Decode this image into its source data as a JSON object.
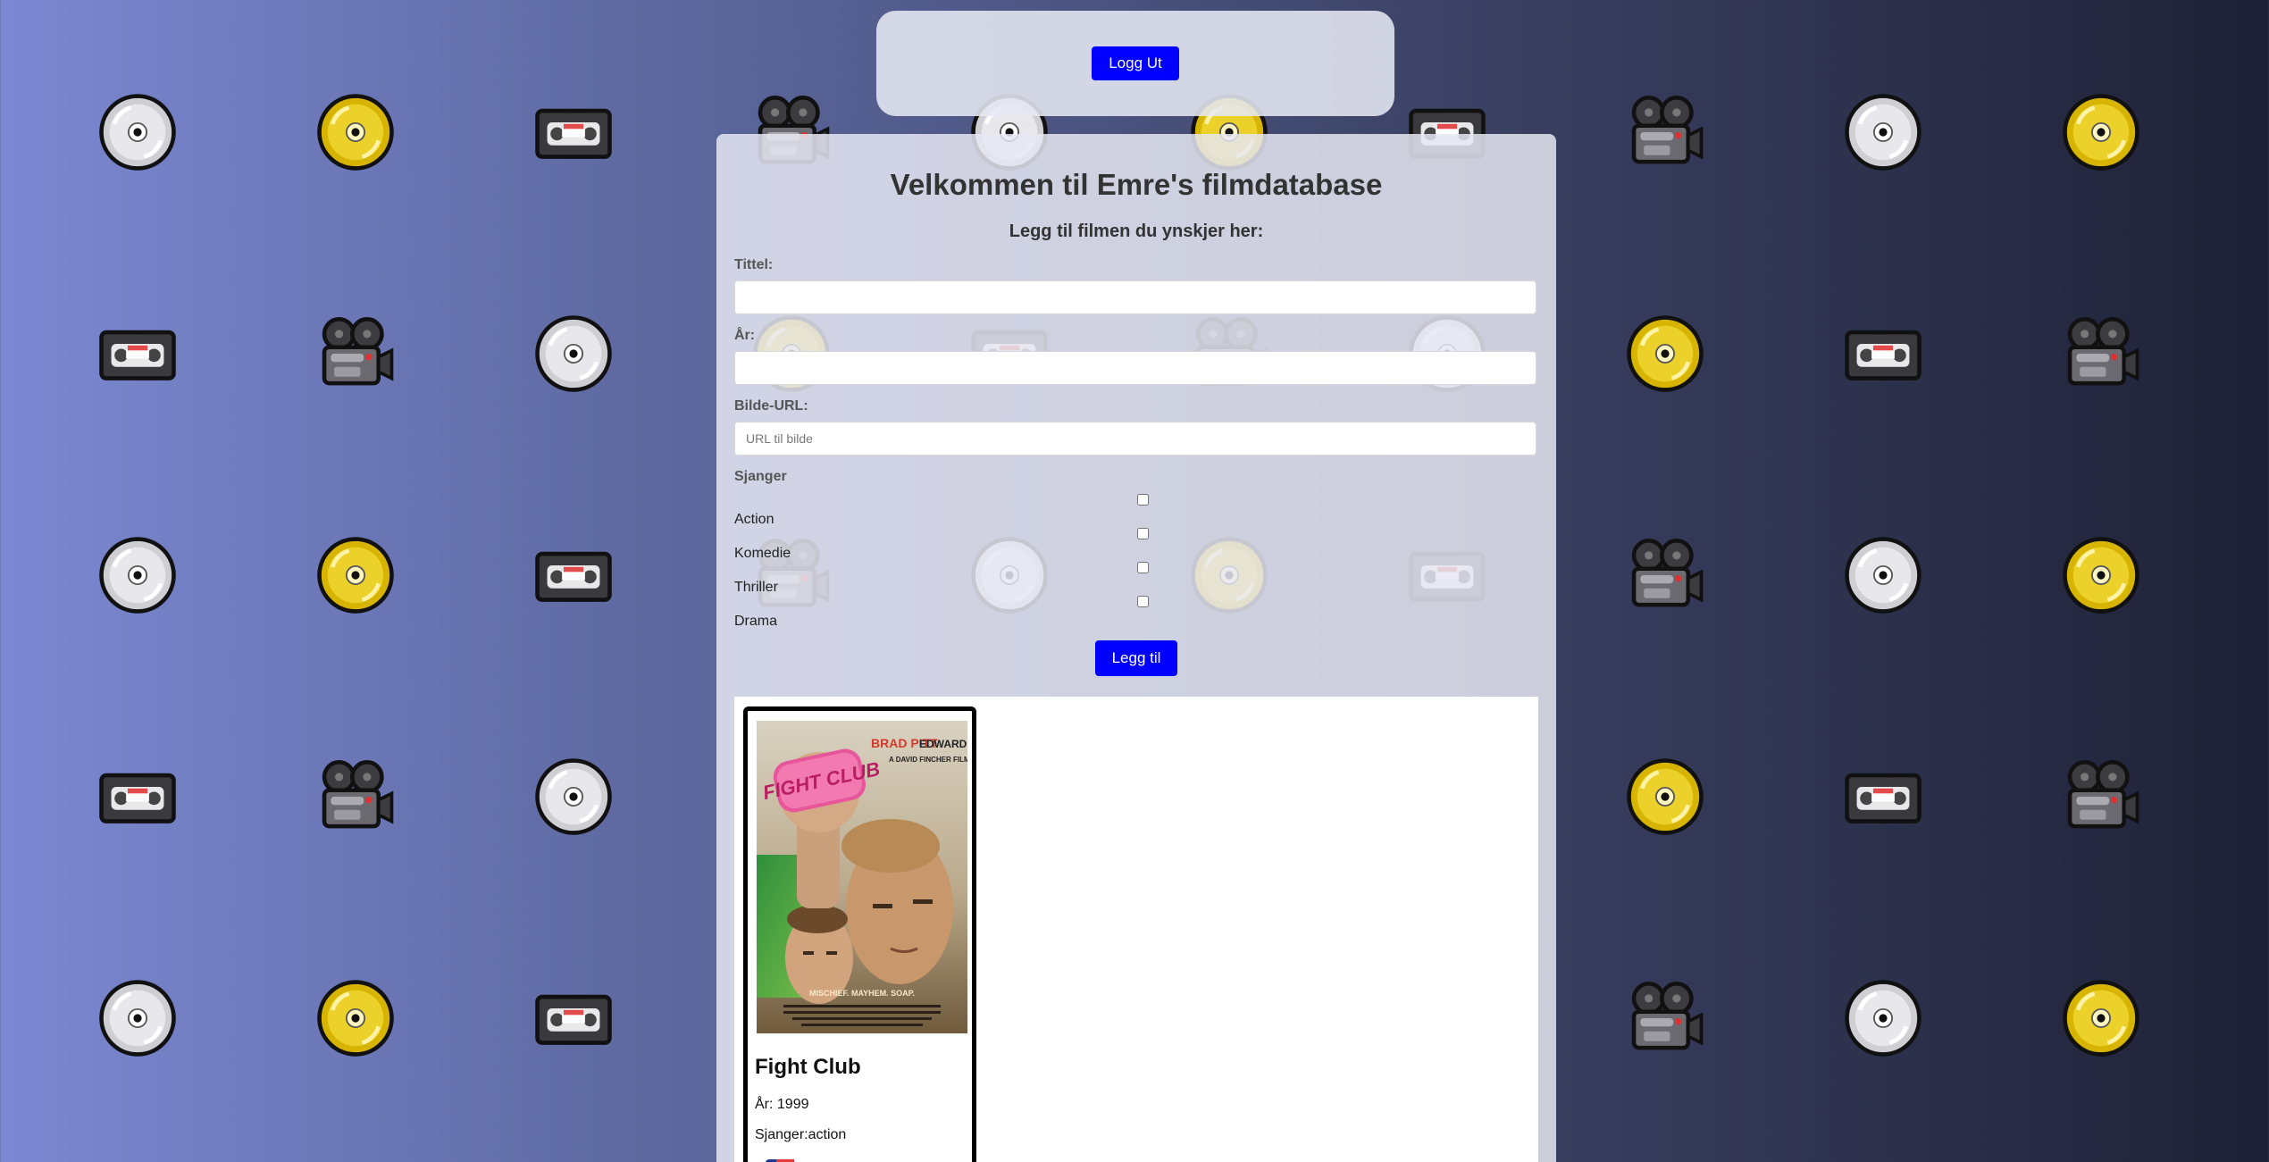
{
  "header": {
    "logout_label": "Logg Ut"
  },
  "main": {
    "title": "Velkommen til Emre's filmdatabase",
    "subtitle": "Legg til filmen du ynskjer her:",
    "form": {
      "title_label": "Tittel:",
      "title_value": "",
      "year_label": "År:",
      "year_value": "",
      "image_label": "Bilde-URL:",
      "image_placeholder": "URL til bilde",
      "image_value": "",
      "genre_heading": "Sjanger",
      "genres": [
        {
          "label": "Action",
          "checked": false
        },
        {
          "label": "Komedie",
          "checked": false
        },
        {
          "label": "Thriller",
          "checked": false
        },
        {
          "label": "Drama",
          "checked": false
        }
      ],
      "submit_label": "Legg til"
    },
    "movies": [
      {
        "title": "Fight Club",
        "year_text": "År: 1999",
        "genre_text": "Sjanger:action",
        "poster": {
          "top_names": [
            "BRAD PITT",
            "EDWARD NORTON"
          ],
          "tagline": "A DAVID FINCHER FILM",
          "logo_text": "FIGHT CLUB",
          "bottom_text": "MISCHIEF. MAYHEM. SOAP."
        }
      }
    ]
  },
  "background": {
    "icon_names": [
      "disc-icon",
      "gold-disc-icon",
      "vhs-tape-icon",
      "movie-camera-icon"
    ]
  }
}
